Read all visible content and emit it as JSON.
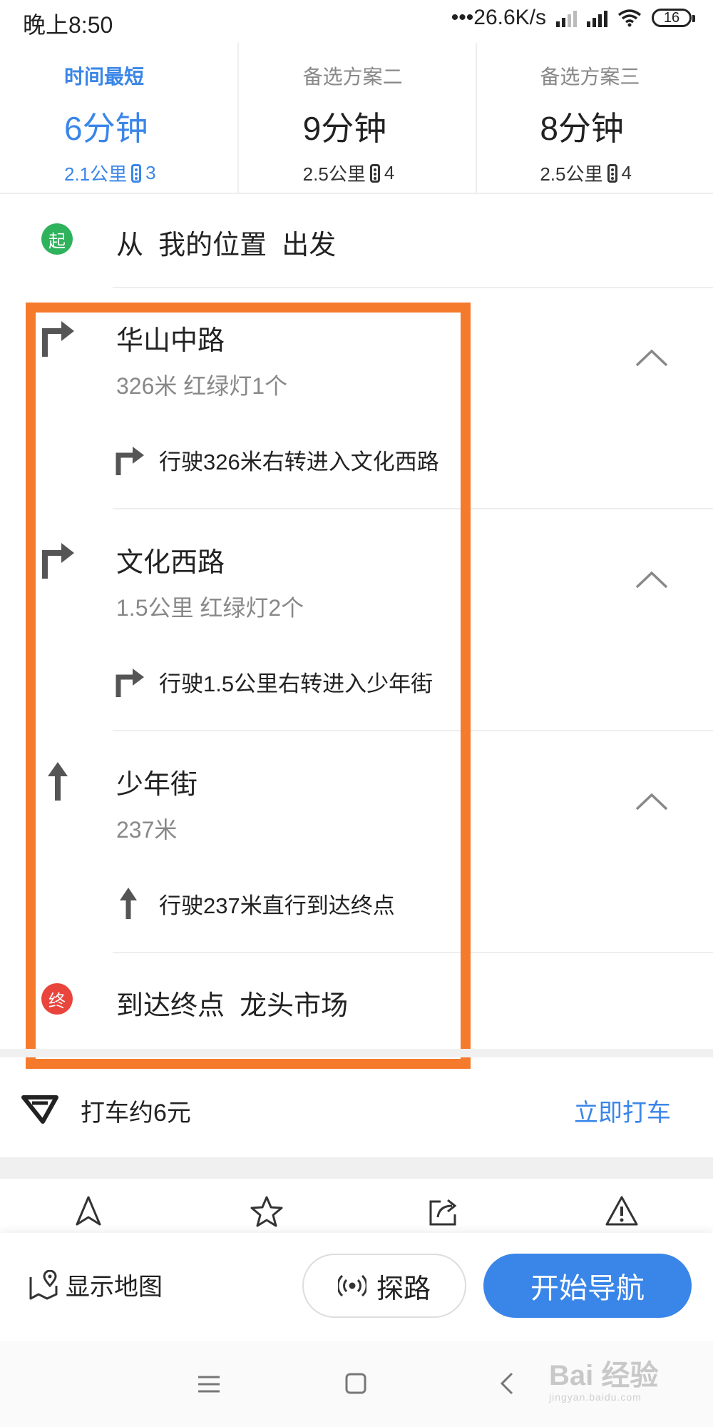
{
  "status_bar": {
    "time": "晚上8:50",
    "network_speed": "•••26.6K/s",
    "battery": "16"
  },
  "route_options": [
    {
      "name": "时间最短",
      "time": "6分钟",
      "distance": "2.1公里",
      "lights": "3",
      "active": true
    },
    {
      "name": "备选方案二",
      "time": "9分钟",
      "distance": "2.5公里",
      "lights": "4",
      "active": false
    },
    {
      "name": "备选方案三",
      "time": "8分钟",
      "distance": "2.5公里",
      "lights": "4",
      "active": false
    }
  ],
  "start": {
    "badge": "起",
    "prefix": "从",
    "place": "我的位置",
    "suffix": "出发"
  },
  "segments": [
    {
      "road": "华山中路",
      "meta": "326米 红绿灯1个",
      "instruction": "行驶326米右转进入文化西路",
      "turn": "right"
    },
    {
      "road": "文化西路",
      "meta": "1.5公里 红绿灯2个",
      "instruction": "行驶1.5公里右转进入少年街",
      "turn": "right"
    },
    {
      "road": "少年街",
      "meta": "237米",
      "instruction": "行驶237米直行到达终点",
      "turn": "straight"
    }
  ],
  "end": {
    "badge": "终",
    "prefix": "到达终点",
    "place": "龙头市场"
  },
  "taxi": {
    "text": "打车约6元",
    "action": "立即打车"
  },
  "actions": [
    "navigate-icon",
    "star-icon",
    "share-icon",
    "warning-icon"
  ],
  "bottom_bar": {
    "show_map": "显示地图",
    "explore": "探路",
    "start_nav": "开始导航"
  },
  "watermark": {
    "text": "Bai 经验",
    "sub": "jingyan.baidu.com"
  },
  "colors": {
    "accent": "#3a86e8",
    "start_badge": "#2fb25c",
    "end_badge": "#e9453d",
    "highlight": "#f57a2c"
  }
}
